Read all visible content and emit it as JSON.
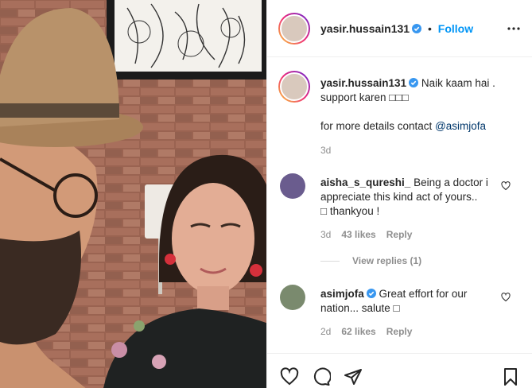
{
  "post": {
    "author": {
      "username": "yasir.hussain131",
      "verified": true
    },
    "follow_label": "Follow",
    "separator": "•",
    "caption": {
      "line1": "Naik kaam hai .",
      "line2": "support karen □□□",
      "line3": "for more details contact",
      "mention": "@asimjofa",
      "age": "3d"
    },
    "comments": [
      {
        "username": "aisha_s_qureshi_",
        "verified": false,
        "line1": "Being a doctor i",
        "line2": "appreciate this kind act of yours..",
        "line3": "□ thankyou !",
        "age": "3d",
        "likes": "43 likes",
        "reply": "Reply",
        "view_replies": "View replies (1)"
      },
      {
        "username": "asimjofa",
        "verified": true,
        "line1": "Great effort for our",
        "line2": "nation... salute □",
        "age": "2d",
        "likes": "62 likes",
        "reply": "Reply"
      }
    ]
  },
  "icons": {
    "more": "more-options-icon",
    "verified": "verified-badge-icon",
    "like_comment": "heart-outline-icon",
    "like": "heart-icon",
    "comment": "comment-icon",
    "share": "paper-plane-icon",
    "save": "bookmark-icon"
  },
  "colors": {
    "link": "#0095f6",
    "muted": "#8e8e8e",
    "verified": "#3897f0",
    "mention": "#00376b",
    "text": "#262626"
  }
}
